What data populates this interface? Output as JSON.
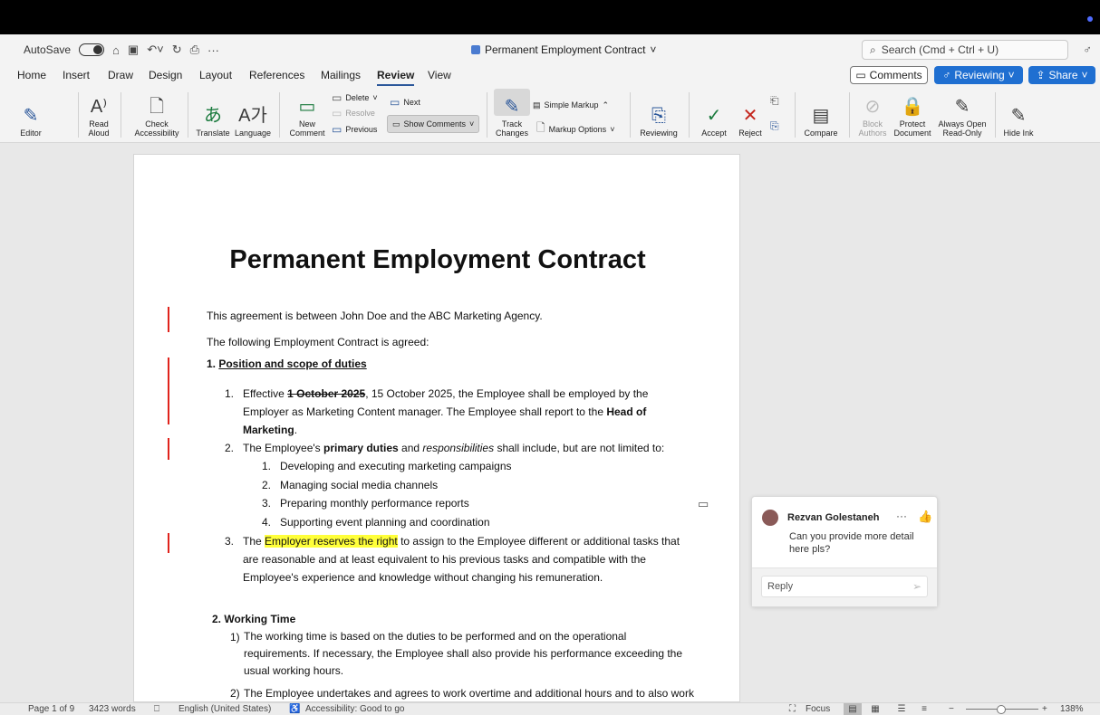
{
  "titlebar": {
    "autosave": "AutoSave",
    "doc_title": "Permanent Employment Contract",
    "search_placeholder": "Search (Cmd + Ctrl + U)"
  },
  "tabs": [
    "Home",
    "Insert",
    "Draw",
    "Design",
    "Layout",
    "References",
    "Mailings",
    "Review",
    "View"
  ],
  "active_tab": "Review",
  "header_buttons": {
    "comments": "Comments",
    "reviewing": "Reviewing",
    "share": "Share"
  },
  "ribbon": {
    "editor": "Editor",
    "read_aloud": [
      "Read",
      "Aloud"
    ],
    "check_accessibility": [
      "Check",
      "Accessibility"
    ],
    "translate": "Translate",
    "language": "Language",
    "new_comment": [
      "New",
      "Comment"
    ],
    "delete": "Delete",
    "resolve": "Resolve",
    "previous": "Previous",
    "next": "Next",
    "show_comments": "Show Comments",
    "track_changes": [
      "Track",
      "Changes"
    ],
    "simple_markup": "Simple Markup",
    "markup_options": "Markup Options",
    "reviewing": "Reviewing",
    "accept": "Accept",
    "reject": "Reject",
    "compare": "Compare",
    "block_authors": [
      "Block",
      "Authors"
    ],
    "protect_document": [
      "Protect",
      "Document"
    ],
    "always_open": [
      "Always Open",
      "Read-Only"
    ],
    "hide_ink": "Hide Ink"
  },
  "document": {
    "title": "Permanent Employment Contract",
    "intro1": "This agreement is between John Doe and the ABC Marketing Agency.",
    "intro2": "The following Employment Contract is agreed:",
    "sec1_num": "1. ",
    "sec1_title": "Position and scope of duties",
    "item1": {
      "num": "1.",
      "pre": "Effective ",
      "deleted": "1 October 2025",
      "post": ", 15 October 2025, the Employee shall be employed by the",
      "line2": "Employer as Marketing Content manager. The Employee shall report to the ",
      "bold": "Head of",
      "line3_bold": "Marketing",
      "line3_end": "."
    },
    "item2": {
      "num": "2.",
      "pre": "The Employee's ",
      "bold": "primary duties",
      "mid": " and ",
      "italic": "responsibilities",
      "post": " shall include, but are not limited to:"
    },
    "subitems": [
      {
        "num": "1.",
        "text": "Developing and executing marketing campaigns"
      },
      {
        "num": "2.",
        "text": "Managing social media channels"
      },
      {
        "num": "3.",
        "text": "Preparing monthly performance reports"
      },
      {
        "num": "4.",
        "text": "Supporting event planning and coordination"
      }
    ],
    "item3": {
      "num": "3.",
      "pre": "The ",
      "highlight": "Employer reserves the right",
      "post": " to assign to the Employee different or additional tasks that",
      "line2": "are reasonable and at least equivalent to his previous tasks and compatible with the",
      "line3": "Employee's experience and knowledge without changing his remuneration."
    },
    "sec2_title": "2. Working Time",
    "wt1": {
      "num": "1)",
      "line1": "The working time is based on the duties to be performed and on the operational",
      "line2": "requirements. If necessary, the Employee shall also provide his performance exceeding the",
      "line3": "usual working hours."
    },
    "wt2": {
      "num": "2)",
      "line1": "The Employee undertakes and agrees to work overtime and additional hours and to also work"
    }
  },
  "comment": {
    "author": "Rezvan Golestaneh",
    "text": "Can you provide more detail here pls?",
    "reply_placeholder": "Reply"
  },
  "statusbar": {
    "page": "Page 1 of 9",
    "words": "3423 words",
    "language": "English (United States)",
    "accessibility": "Accessibility: Good to go",
    "focus": "Focus",
    "zoom": "138%"
  }
}
